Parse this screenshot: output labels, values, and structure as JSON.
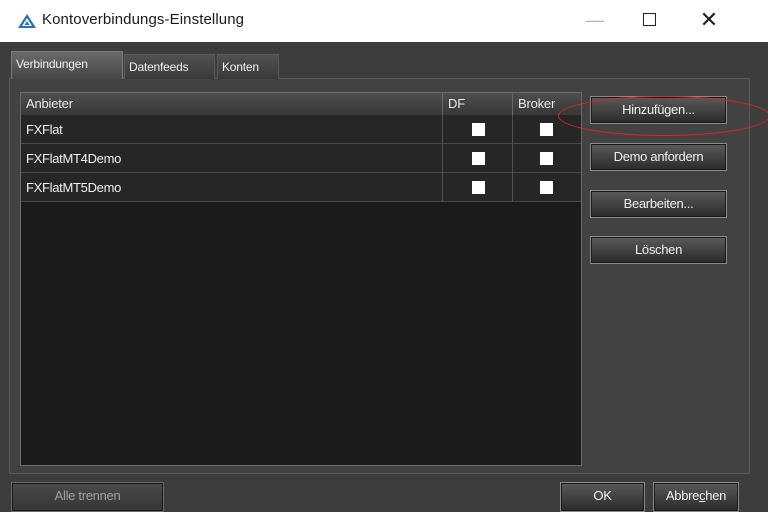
{
  "window": {
    "title": "Kontoverbindungs-Einstellung",
    "minimize_glyph": "—",
    "close_glyph": "✕",
    "icon": "triangle-app-icon"
  },
  "tabs": [
    {
      "label": "Verbindungen",
      "active": true
    },
    {
      "label": "Datenfeeds",
      "active": false
    },
    {
      "label": "Konten",
      "active": false
    }
  ],
  "table": {
    "columns": [
      "Anbieter",
      "DF",
      "Broker"
    ],
    "rows": [
      {
        "name": "FXFlat",
        "df": false,
        "broker": false
      },
      {
        "name": "FXFlatMT4Demo",
        "df": false,
        "broker": false
      },
      {
        "name": "FXFlatMT5Demo",
        "df": false,
        "broker": false
      }
    ]
  },
  "side_buttons": {
    "add": "Hinzufügen...",
    "demo": "Demo anfordern",
    "edit": "Bearbeiten...",
    "delete": "Löschen"
  },
  "bottom": {
    "disconnect_all": "Alle trennen",
    "ok": "OK",
    "cancel_pre": "Abbre",
    "cancel_accel": "c",
    "cancel_post": "hen"
  },
  "colors": {
    "dialog_bg": "#3d3d3d",
    "list_bg": "#1b1b1b",
    "highlight": "#e3212a"
  }
}
